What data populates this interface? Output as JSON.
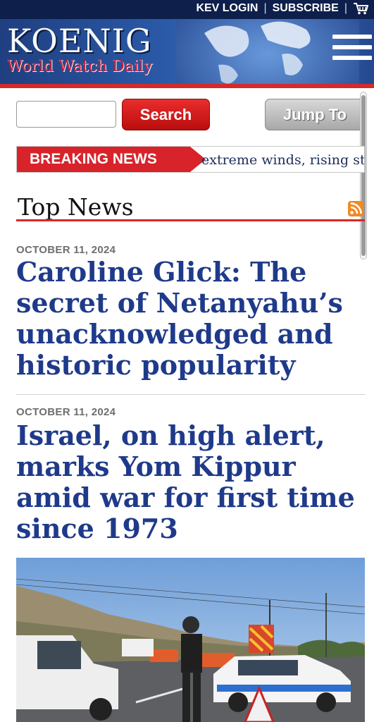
{
  "header": {
    "login_label": "KEV LOGIN",
    "subscribe_label": "SUBSCRIBE",
    "separator": "|",
    "cart_icon": "cart-icon",
    "logo_title": "KOENIG",
    "logo_subtitle": "World Watch Daily",
    "menu_icon": "hamburger-menu-icon"
  },
  "search": {
    "placeholder": "",
    "value": "",
    "search_label": "Search",
    "jump_label": "Jump To"
  },
  "breaking": {
    "label": "BREAKING NEWS",
    "ticker": "extreme winds, rising sto"
  },
  "section": {
    "title": "Top News",
    "rss_icon": "rss-icon"
  },
  "articles": [
    {
      "date": "OCTOBER 11, 2024",
      "headline": "Caroline Glick: The secret of Netanyahu’s unacknowledged and historic popularity"
    },
    {
      "date": "OCTOBER 11, 2024",
      "headline": "Israel, on high alert, marks Yom Kippur amid war for first time since 1973"
    }
  ],
  "colors": {
    "topbar": "#0d1f4a",
    "accent_red": "#d52a2a",
    "headline_blue": "#1f3a8a"
  }
}
